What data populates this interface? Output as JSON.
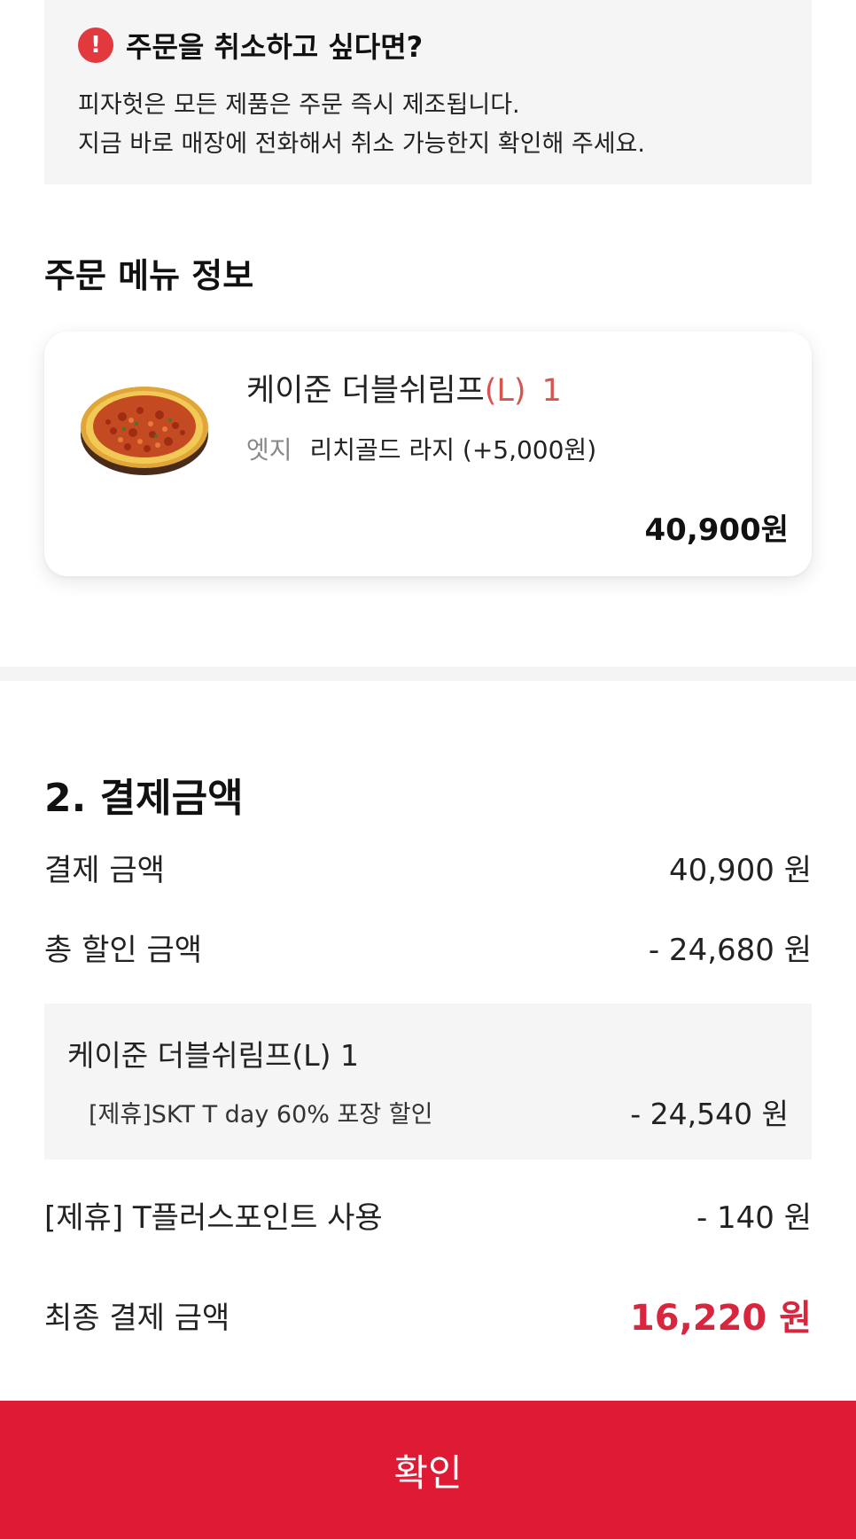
{
  "notice": {
    "icon": "exclamation-icon",
    "icon_glyph": "!",
    "title": "주문을 취소하고 싶다면?",
    "line1": "피자헛은 모든 제품은 주문 즉시 제조됩니다.",
    "line2": "지금 바로 매장에 전화해서 취소 가능한지 확인해 주세요."
  },
  "menu_section": {
    "title": "주문 메뉴 정보",
    "item": {
      "image": "pizza-icon",
      "name": "케이준 더블쉬림프",
      "size": "(L)",
      "quantity": "1",
      "option_label": "엣지",
      "option_value": "리치골드 라지 (+5,000원)",
      "price": "40,900원"
    }
  },
  "payment_section": {
    "title": "2. 결제금액",
    "payment_amount": {
      "label": "결제 금액",
      "value": "40,900 원"
    },
    "total_discount": {
      "label": "총 할인 금액",
      "value": "- 24,680 원"
    },
    "discount_detail": {
      "item_name": "케이준 더블쉬림프(L) 1",
      "label": "[제휴]SKT T day 60% 포장 할인",
      "value": "- 24,540 원"
    },
    "point_use": {
      "label": "[제휴] T플러스포인트 사용",
      "value": "- 140 원"
    },
    "final_amount": {
      "label": "최종 결제 금액",
      "value": "16,220 원"
    }
  },
  "confirm_button": {
    "label": "확인"
  },
  "colors": {
    "accent": "#de1a34",
    "final_amount": "#d7263d",
    "size_text": "#d9534f",
    "notice_bg": "#f5f5f5"
  }
}
